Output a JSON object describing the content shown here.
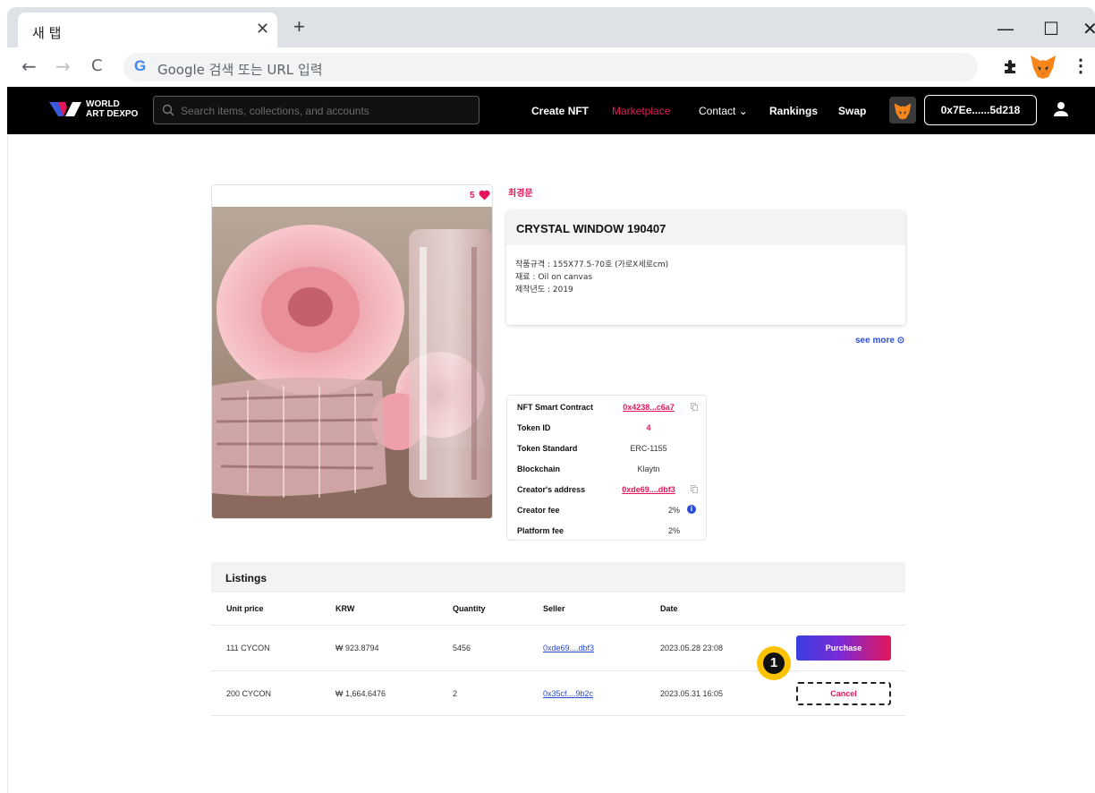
{
  "browser": {
    "tab_title": "새 탭",
    "tab_close": "✕",
    "new_tab": "+",
    "address_placeholder": "Google 검색 또는 URL 입력",
    "minimize": "—",
    "maximize": "☐",
    "close": "✕",
    "back": "←",
    "forward": "→",
    "reload": "C",
    "google_logo": "G",
    "menu": "⋮"
  },
  "site": {
    "logo_line1": "WORLD",
    "logo_line2": "ART DEXPO",
    "search_placeholder": "Search items, collections, and accounts",
    "nav": {
      "create": "Create NFT",
      "marketplace": "Marketplace",
      "contact": "Contact ⌄",
      "rankings": "Rankings",
      "swap": "Swap"
    },
    "wallet": "0x7Ee......5d218",
    "accent_color": "#e5175a"
  },
  "artwork": {
    "likes": "5",
    "artist": "최경문",
    "title": "CRYSTAL WINDOW 190407",
    "details": [
      "작품규격 : 155X77.5-70호 (가로X세로cm)",
      "재료 : Oil on canvas",
      "제작년도 : 2019"
    ],
    "see_more": "see more ⊙"
  },
  "specs": [
    {
      "label": "NFT Smart Contract",
      "value": "0x4238...c6a7"
    },
    {
      "label": "Token ID",
      "value": "4"
    },
    {
      "label": "Token Standard",
      "value": "ERC-1155"
    },
    {
      "label": "Blockchain",
      "value": "Klaytn"
    },
    {
      "label": "Creator's address",
      "value": "0xde69....dbf3"
    },
    {
      "label": "Creator fee",
      "value": "2%"
    },
    {
      "label": "Platform fee",
      "value": "2%"
    }
  ],
  "listings": {
    "title": "Listings",
    "columns": [
      "Unit price",
      "KRW",
      "Quantity",
      "Seller",
      "Date"
    ],
    "rows": [
      {
        "price": "111 CYCON",
        "krw": "₩ 923.8794",
        "qty": "5456",
        "seller": "0xde69....dbf3",
        "date": "2023.05.28 23:08",
        "action": "Purchase"
      },
      {
        "price": "200 CYCON",
        "krw": "₩ 1,664.6476",
        "qty": "2",
        "seller": "0x35cf....9b2c",
        "date": "2023.05.31 16:05",
        "action": "Cancel"
      }
    ]
  },
  "annotation": {
    "step": "1"
  }
}
